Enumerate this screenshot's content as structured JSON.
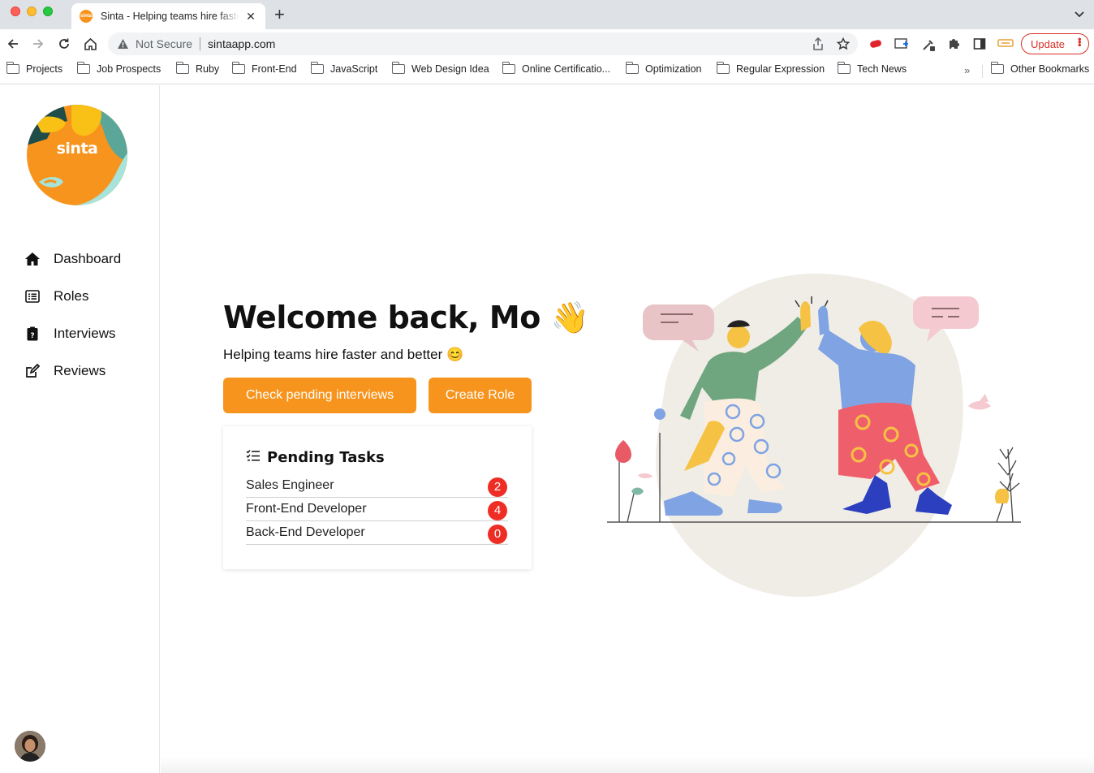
{
  "browser": {
    "tab_title": "Sinta - Helping teams hire faster and better",
    "favicon_text": "sinta",
    "not_secure_label": "Not Secure",
    "url": "sintaapp.com",
    "update_label": "Update",
    "bookmarks": [
      "Projects",
      "Job Prospects",
      "Ruby",
      "Front-End",
      "JavaScript",
      "Web Design Idea",
      "Online Certificatio...",
      "Optimization",
      "Regular Expression",
      "Tech News"
    ],
    "more_label": "»",
    "other_bookmarks": "Other Bookmarks"
  },
  "sidebar": {
    "logo_text": "sinta",
    "items": [
      {
        "label": "Dashboard",
        "icon": "home-icon"
      },
      {
        "label": "Roles",
        "icon": "list-icon"
      },
      {
        "label": "Interviews",
        "icon": "clipboard-question-icon"
      },
      {
        "label": "Reviews",
        "icon": "edit-icon"
      }
    ]
  },
  "main": {
    "welcome": "Welcome back, Mo 👋",
    "subtitle": "Helping teams hire faster and better 😊",
    "buttons": {
      "pending": "Check pending interviews",
      "create": "Create Role"
    },
    "pending_tasks": {
      "title": "Pending Tasks",
      "rows": [
        {
          "label": "Sales Engineer",
          "count": "2"
        },
        {
          "label": "Front-End Developer",
          "count": "4"
        },
        {
          "label": "Back-End Developer",
          "count": "0"
        }
      ]
    }
  },
  "colors": {
    "accent": "#f7941d",
    "badge": "#ee2e24"
  }
}
